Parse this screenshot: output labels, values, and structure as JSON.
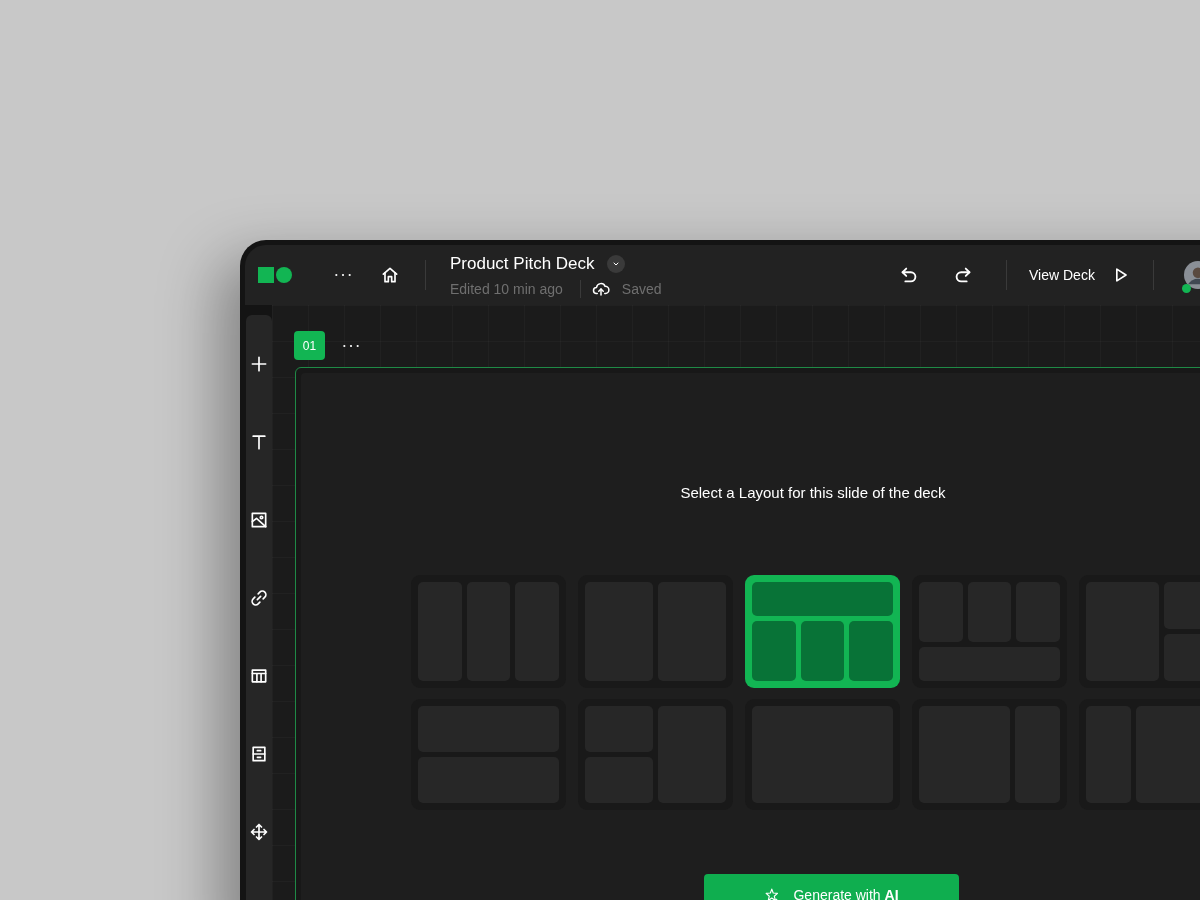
{
  "header": {
    "title": "Product Pitch Deck",
    "edited": "Edited 10 min ago",
    "save_status": "Saved",
    "view_button": "View Deck"
  },
  "sidebar": {
    "tools": [
      {
        "kind": "add"
      },
      {
        "kind": "text"
      },
      {
        "kind": "image"
      },
      {
        "kind": "link"
      },
      {
        "kind": "table"
      },
      {
        "kind": "form"
      },
      {
        "kind": "move"
      }
    ]
  },
  "slide": {
    "number": "01",
    "prompt": "Select a Layout for this slide of the deck",
    "layouts": [
      {
        "kind": "three-columns",
        "selected": false
      },
      {
        "kind": "two-columns",
        "selected": false
      },
      {
        "kind": "header-three-columns",
        "selected": true
      },
      {
        "kind": "three-over-wide",
        "selected": false
      },
      {
        "kind": "wide-plus-stack",
        "selected": false
      },
      {
        "kind": "two-rows",
        "selected": false
      },
      {
        "kind": "stack-plus-tall",
        "selected": false
      },
      {
        "kind": "single",
        "selected": false
      },
      {
        "kind": "wide-plus-narrow",
        "selected": false
      },
      {
        "kind": "narrow-plus-wide",
        "selected": false
      }
    ],
    "generate_button": "Generate with **AI**"
  }
}
